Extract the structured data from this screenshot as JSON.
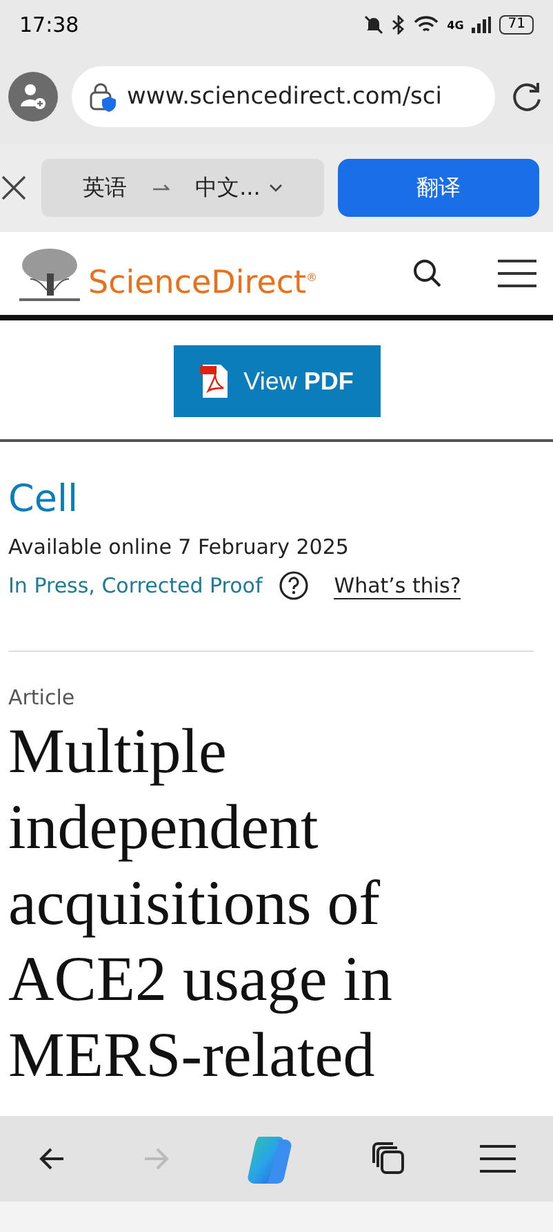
{
  "status_bar": {
    "time": "17:38",
    "network": "4G",
    "battery": "71"
  },
  "address_bar": {
    "url": "www.sciencedirect.com/sci"
  },
  "translate_bar": {
    "source_language": "英语",
    "swap": "⇀",
    "target_language": "中文...",
    "translate_button": "翻译"
  },
  "site_header": {
    "logo_text": "ScienceDirect",
    "logo_mark": "®"
  },
  "view_pdf_button": {
    "label": "View ",
    "label_bold": "PDF"
  },
  "article_info": {
    "journal": "Cell",
    "available": "Available online 7 February 2025",
    "status": "In Press, Corrected Proof",
    "help_link": "What’s this?"
  },
  "article": {
    "type": "Article",
    "title": "Multiple independent acquisitions of ACE2 usage in MERS-related"
  },
  "bottom_nav": [
    {
      "kind": "back",
      "disabled": false
    },
    {
      "kind": "forward",
      "disabled": true
    },
    {
      "kind": "copilot",
      "disabled": false
    },
    {
      "kind": "tabs",
      "disabled": false
    },
    {
      "kind": "menu",
      "disabled": false
    }
  ]
}
